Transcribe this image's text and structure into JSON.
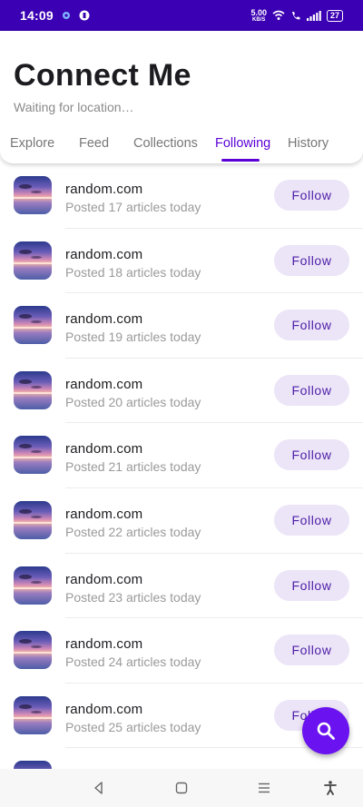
{
  "status_bar": {
    "time": "14:09",
    "net_speed_value": "5.00",
    "net_speed_unit": "KB/S",
    "battery": "27"
  },
  "header": {
    "title": "Connect Me",
    "subtitle": "Waiting for location…"
  },
  "tabs": [
    {
      "label": "Explore"
    },
    {
      "label": "Feed"
    },
    {
      "label": "Collections"
    },
    {
      "label": "Following",
      "active": true
    },
    {
      "label": "History"
    }
  ],
  "list": {
    "items": [
      {
        "title": "random.com",
        "subtitle": "Posted 17 articles today",
        "button": "Follow"
      },
      {
        "title": "random.com",
        "subtitle": "Posted 18 articles today",
        "button": "Follow"
      },
      {
        "title": "random.com",
        "subtitle": "Posted 19 articles today",
        "button": "Follow"
      },
      {
        "title": "random.com",
        "subtitle": "Posted 20 articles today",
        "button": "Follow"
      },
      {
        "title": "random.com",
        "subtitle": "Posted 21 articles today",
        "button": "Follow"
      },
      {
        "title": "random.com",
        "subtitle": "Posted 22 articles today",
        "button": "Follow"
      },
      {
        "title": "random.com",
        "subtitle": "Posted 23 articles today",
        "button": "Follow"
      },
      {
        "title": "random.com",
        "subtitle": "Posted 24 articles today",
        "button": "Follow"
      },
      {
        "title": "random.com",
        "subtitle": "Posted 25 articles today",
        "button": "Follow"
      }
    ]
  },
  "fab": {
    "icon": "search-icon"
  },
  "colors": {
    "accent": "#5a00d6",
    "status_bar": "#3b00b3",
    "follow_button_bg": "#ece4f7",
    "fab": "#6a12f0"
  },
  "nav_bar": {
    "icons": [
      "back-icon",
      "home-icon",
      "recents-icon",
      "accessibility-icon"
    ]
  }
}
